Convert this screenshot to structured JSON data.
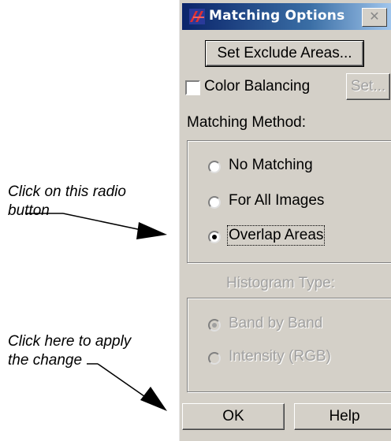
{
  "annotations": {
    "radio_note_line1": "Click on this radio",
    "radio_note_line2": "button",
    "apply_note_line1": "Click here to apply",
    "apply_note_line2": "the change"
  },
  "dialog": {
    "title": "Matching Options",
    "close_glyph": "✕",
    "set_exclude_label": "Set Exclude Areas...",
    "color_balancing_label": "Color Balancing",
    "color_balancing_checked": false,
    "set_label": "Set...",
    "matching_method_label": "Matching Method:",
    "matching_options": [
      "No Matching",
      "For All Images",
      "Overlap Areas"
    ],
    "matching_selected": "Overlap Areas",
    "histogram_type_label": "Histogram Type:",
    "histogram_options": [
      "Band by Band",
      "Intensity (RGB)"
    ],
    "histogram_selected": "Band by Band",
    "ok_label": "OK",
    "help_label": "Help"
  }
}
